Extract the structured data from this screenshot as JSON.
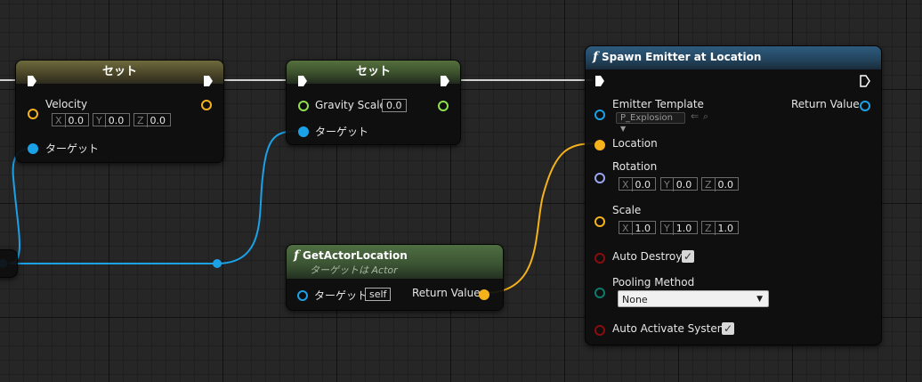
{
  "colors": {
    "exec": "#ffffff",
    "vector_pin": "#f5b21b",
    "object_pin": "#1aa1e6",
    "float_pin": "#8fe04d",
    "rotator_pin": "#9aa6f2",
    "bool_pin": "#8a0d0d",
    "enum_pin": "#0d7a6c",
    "wire_object": "#1aa1e6",
    "wire_vector": "#f5b21b",
    "wire_exec": "#d8d8d8"
  },
  "set_node_1": {
    "title": "セット",
    "velocity_label": "Velocity",
    "velocity": {
      "x_axis": "X",
      "x": "0.0",
      "y_axis": "Y",
      "y": "0.0",
      "z_axis": "Z",
      "z": "0.0"
    },
    "target_label": "ターゲット"
  },
  "set_node_2": {
    "title": "セット",
    "gravity_label": "Gravity Scale",
    "gravity_value": "0.0",
    "target_label": "ターゲット"
  },
  "get_actor_location": {
    "title": "GetActorLocation",
    "subtitle": "ターゲットは Actor",
    "target_label": "ターゲット",
    "target_value": "self",
    "return_label": "Return Value"
  },
  "spawn_emitter": {
    "title": "Spawn Emitter at Location",
    "emitter_template_label": "Emitter Template",
    "emitter_template_value": "P_Explosion",
    "return_label": "Return Value",
    "location_label": "Location",
    "rotation_label": "Rotation",
    "rotation": {
      "x_axis": "X",
      "x": "0.0",
      "y_axis": "Y",
      "y": "0.0",
      "z_axis": "Z",
      "z": "0.0"
    },
    "scale_label": "Scale",
    "scale": {
      "x_axis": "X",
      "x": "1.0",
      "y_axis": "Y",
      "y": "1.0",
      "z_axis": "Z",
      "z": "1.0"
    },
    "auto_destroy_label": "Auto Destroy",
    "auto_destroy_checked": true,
    "pooling_label": "Pooling Method",
    "pooling_value": "None",
    "auto_activate_label": "Auto Activate System",
    "auto_activate_checked": true
  },
  "icons": {
    "function": "f",
    "check": "✓",
    "caret": "▼",
    "use_asset": "⇐",
    "browse_asset": "⌕"
  }
}
